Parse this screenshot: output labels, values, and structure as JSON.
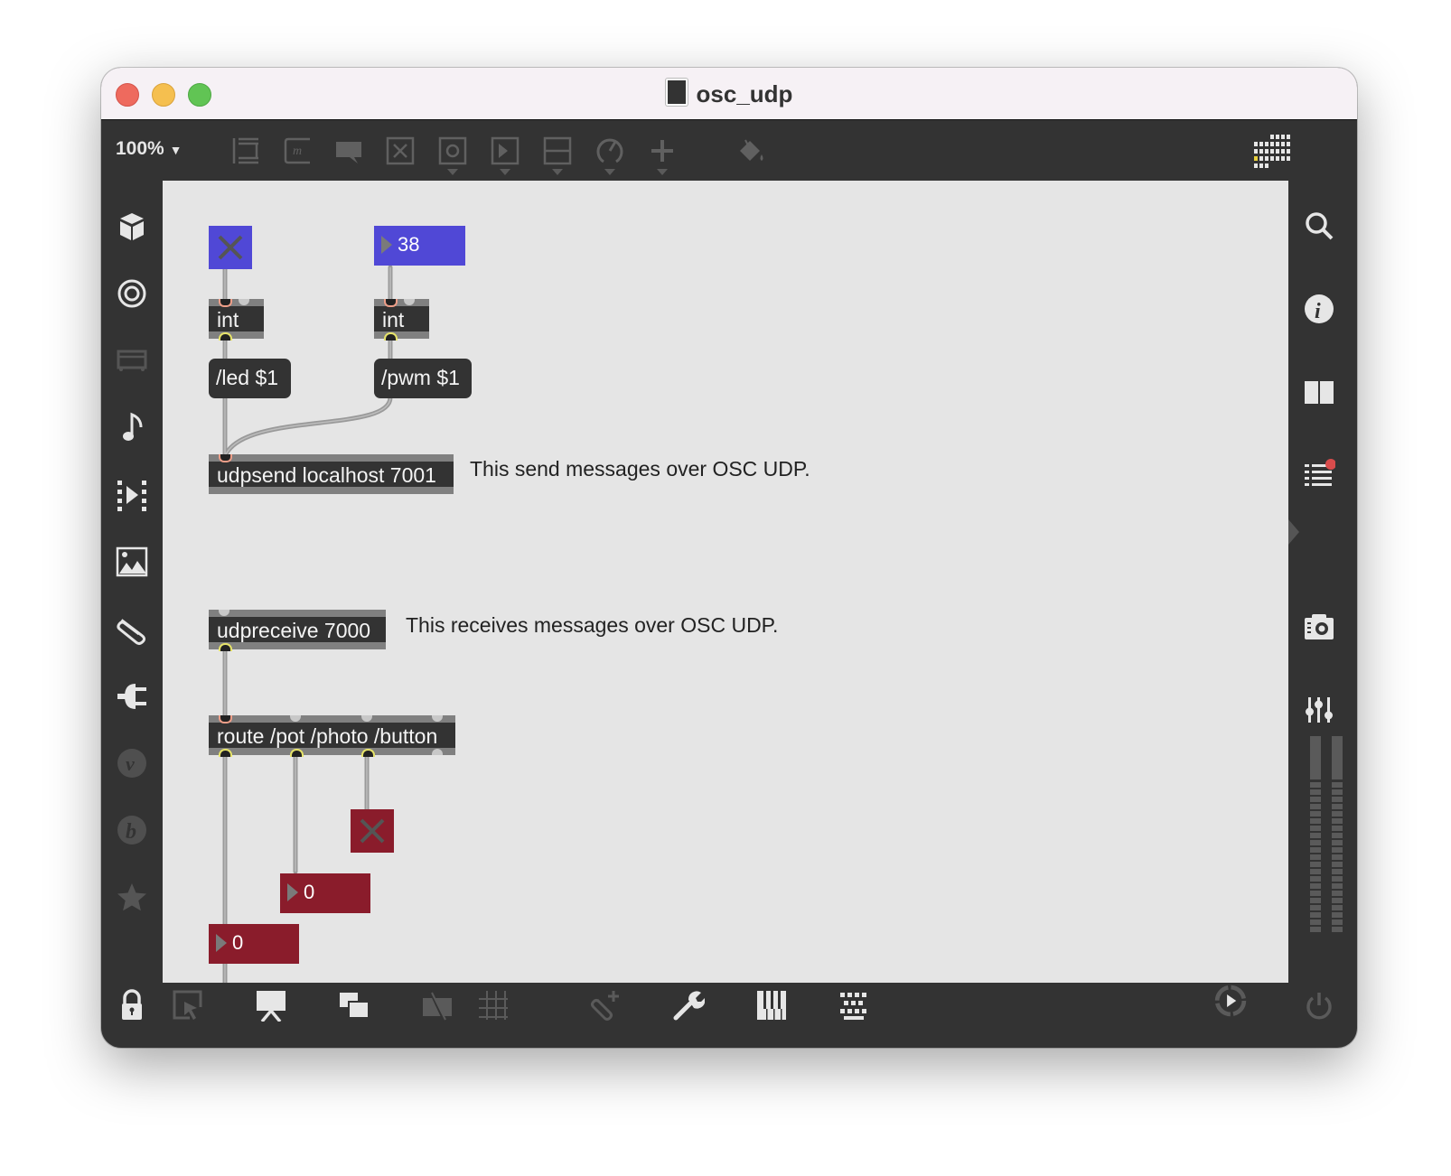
{
  "window": {
    "title": "osc_udp",
    "traffic_lights": {
      "close": "#ee6a5e",
      "minimize": "#f5bf4f",
      "zoom": "#61c454"
    }
  },
  "toolbar": {
    "zoom_level": "100%",
    "icons": [
      "patcher-icon",
      "message-m-icon",
      "comment-icon",
      "button-x-icon",
      "toggle-circle-icon",
      "number-play-icon",
      "slider-minus-icon",
      "dial-icon",
      "plus-icon",
      "paint-bucket-icon"
    ],
    "grid_menu_icon": "app-grid-icon"
  },
  "left_sidebar": {
    "icons": [
      "cube-icon",
      "target-icon",
      "rack-icon",
      "music-note-icon",
      "video-clip-icon",
      "image-icon",
      "paperclip-icon",
      "plug-icon",
      "vst-v-icon",
      "bpatcher-b-icon",
      "star-icon"
    ]
  },
  "right_sidebar": {
    "icons": [
      "search-icon",
      "info-icon",
      "columns-icon",
      "list-icon",
      "snapshot-camera-icon",
      "mixer-icon"
    ],
    "list_badge_color": "#d94c4c"
  },
  "bottom_bar": {
    "icons": [
      "lock-icon",
      "presentation-select-icon",
      "presentation-icon",
      "layers-icon",
      "hide-icon",
      "grid-icon",
      "attach-icon",
      "wrench-icon",
      "piano-icon",
      "keyboard-icon",
      "audio-play-icon",
      "power-icon"
    ]
  },
  "patch": {
    "send": {
      "toggle_color": "#5048d6",
      "number_value": "38",
      "number_color": "#5048d6",
      "int_left": "int",
      "int_right": "int",
      "msg_led": "/led $1",
      "msg_pwm": "/pwm $1",
      "udpsend": "udpsend localhost 7001",
      "comment": "This send messages over OSC UDP."
    },
    "receive": {
      "udpreceive": "udpreceive 7000",
      "comment": "This receives messages over OSC UDP.",
      "route": "route /pot /photo /button",
      "toggle_color": "#8a1c2b",
      "number_photo_value": "0",
      "number_pot_value": "0",
      "number_color": "#8a1c2b"
    }
  }
}
